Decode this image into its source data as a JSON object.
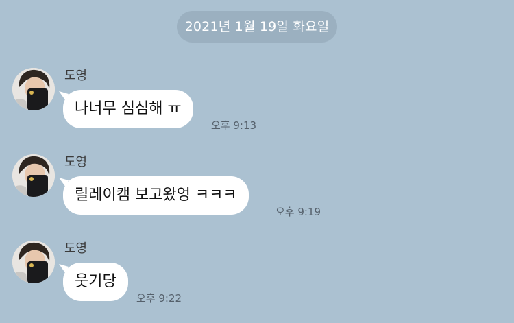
{
  "date_divider": "2021년 1월 19일 화요일",
  "messages": [
    {
      "sender": "도영",
      "text": "나너무 심심해 ㅠ",
      "time": "오후 9:13"
    },
    {
      "sender": "도영",
      "text": "릴레이캠 보고왔엉 ㅋㅋㅋ",
      "time": "오후 9:19"
    },
    {
      "sender": "도영",
      "text": "웃기당",
      "time": "오후 9:22"
    }
  ],
  "colors": {
    "background": "#abc1d1",
    "date_pill": "#9bb0c0",
    "bubble": "#ffffff"
  }
}
